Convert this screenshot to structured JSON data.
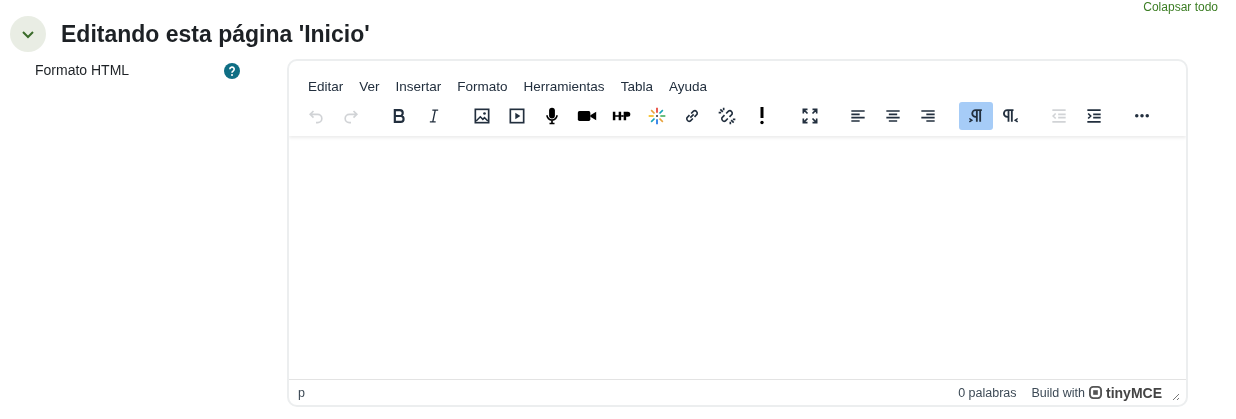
{
  "collapse_link": "Colapsar todo",
  "section": {
    "title": "Editando esta página 'Inicio'",
    "expanded": true
  },
  "field": {
    "label": "Formato HTML"
  },
  "editor": {
    "menu": [
      "Editar",
      "Ver",
      "Insertar",
      "Formato",
      "Herramientas",
      "Tabla",
      "Ayuda"
    ],
    "toolbar": [
      [
        {
          "kind": "undo",
          "disabled": true,
          "selected": false
        },
        {
          "kind": "redo",
          "disabled": true,
          "selected": false
        }
      ],
      [
        {
          "kind": "bold",
          "disabled": false,
          "selected": false
        },
        {
          "kind": "italic",
          "disabled": false,
          "selected": false
        }
      ],
      [
        {
          "kind": "image",
          "disabled": false,
          "selected": false
        },
        {
          "kind": "media",
          "disabled": false,
          "selected": false
        },
        {
          "kind": "mic",
          "disabled": false,
          "selected": false
        },
        {
          "kind": "video",
          "disabled": false,
          "selected": false
        },
        {
          "kind": "h5p",
          "disabled": false,
          "selected": false
        },
        {
          "kind": "sparkle",
          "disabled": false,
          "selected": false
        },
        {
          "kind": "link",
          "disabled": false,
          "selected": false
        },
        {
          "kind": "unlink",
          "disabled": false,
          "selected": false
        },
        {
          "kind": "exclaim",
          "disabled": false,
          "selected": false
        }
      ],
      [
        {
          "kind": "fullscreen",
          "disabled": false,
          "selected": false
        }
      ],
      [
        {
          "kind": "alignleft",
          "disabled": false,
          "selected": false
        },
        {
          "kind": "aligncenter",
          "disabled": false,
          "selected": false
        },
        {
          "kind": "alignright",
          "disabled": false,
          "selected": false
        }
      ],
      [
        {
          "kind": "ltr",
          "disabled": false,
          "selected": true
        },
        {
          "kind": "rtl",
          "disabled": false,
          "selected": false
        }
      ],
      [
        {
          "kind": "outdent",
          "disabled": true,
          "selected": false
        },
        {
          "kind": "indent",
          "disabled": false,
          "selected": false
        }
      ],
      [
        {
          "kind": "more",
          "disabled": false,
          "selected": false
        }
      ]
    ],
    "status": {
      "path": "p",
      "wordcount": "0 palabras",
      "branding": "Build with",
      "brand": "tinyMCE"
    }
  }
}
